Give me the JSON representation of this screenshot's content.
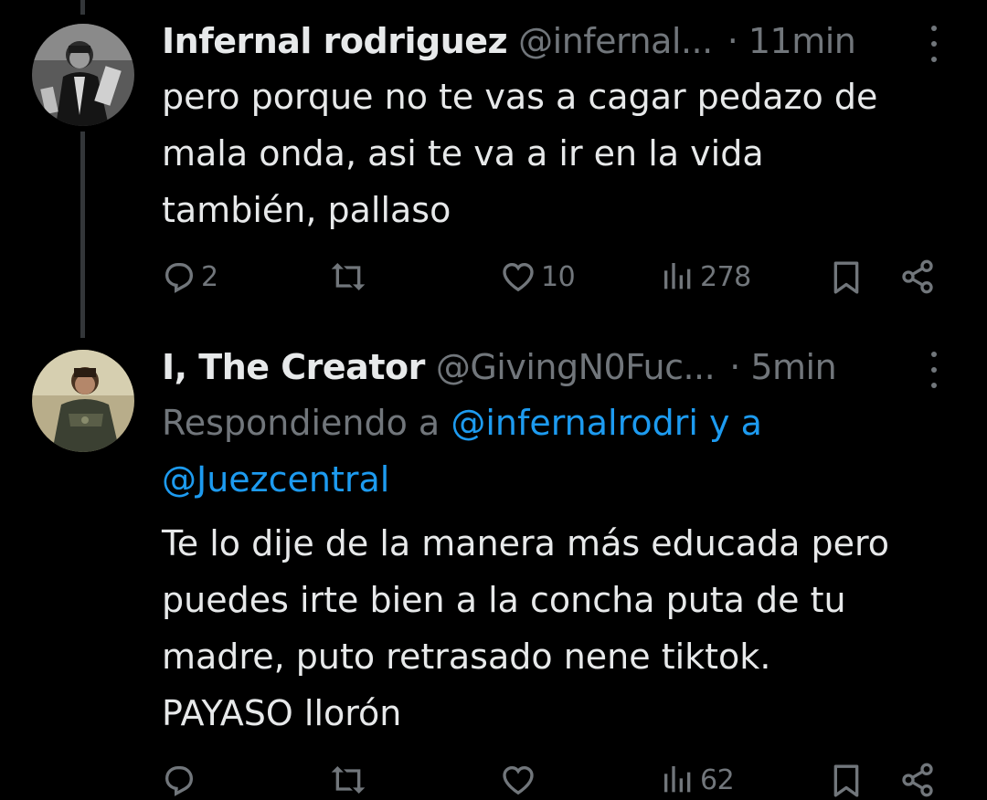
{
  "colors": {
    "background": "#000000",
    "text": "#e7e9ea",
    "muted": "#71767b",
    "link": "#1d9bf0",
    "thread_line": "#333639"
  },
  "tweets": [
    {
      "name": "Infernal rodriguez",
      "handle": "@infernal...",
      "time": "· 11min",
      "avatar": "avatar-person-bw",
      "text_lines": [
        "pero porque no te vas a cagar pedazo de",
        "mala onda, asi te va a ir en la vida",
        "también, pallaso"
      ],
      "actions": {
        "reply_count": "2",
        "retweet_count": "",
        "like_count": "10",
        "views_count": "278"
      },
      "icons": [
        "reply-icon",
        "retweet-icon",
        "like-icon",
        "views-icon",
        "bookmark-icon",
        "share-icon",
        "more-icon"
      ]
    },
    {
      "name": "I, The Creator",
      "handle": "@GivingN0Fuc...",
      "time": "· 5min",
      "avatar": "avatar-person-color",
      "replying_prefix": "Respondiendo a",
      "replying_mention_1": "@infernalrodri y a",
      "replying_mention_2": "@Juezcentral",
      "text_lines": [
        "Te lo dije de la manera más educada pero",
        "puedes irte bien a la concha puta de tu",
        "madre, puto retrasado nene tiktok.",
        "PAYASO llorón"
      ],
      "actions": {
        "reply_count": "",
        "retweet_count": "",
        "like_count": "",
        "views_count": "62"
      },
      "icons": [
        "reply-icon",
        "retweet-icon",
        "like-icon",
        "views-icon",
        "bookmark-icon",
        "share-icon",
        "more-icon"
      ]
    }
  ]
}
